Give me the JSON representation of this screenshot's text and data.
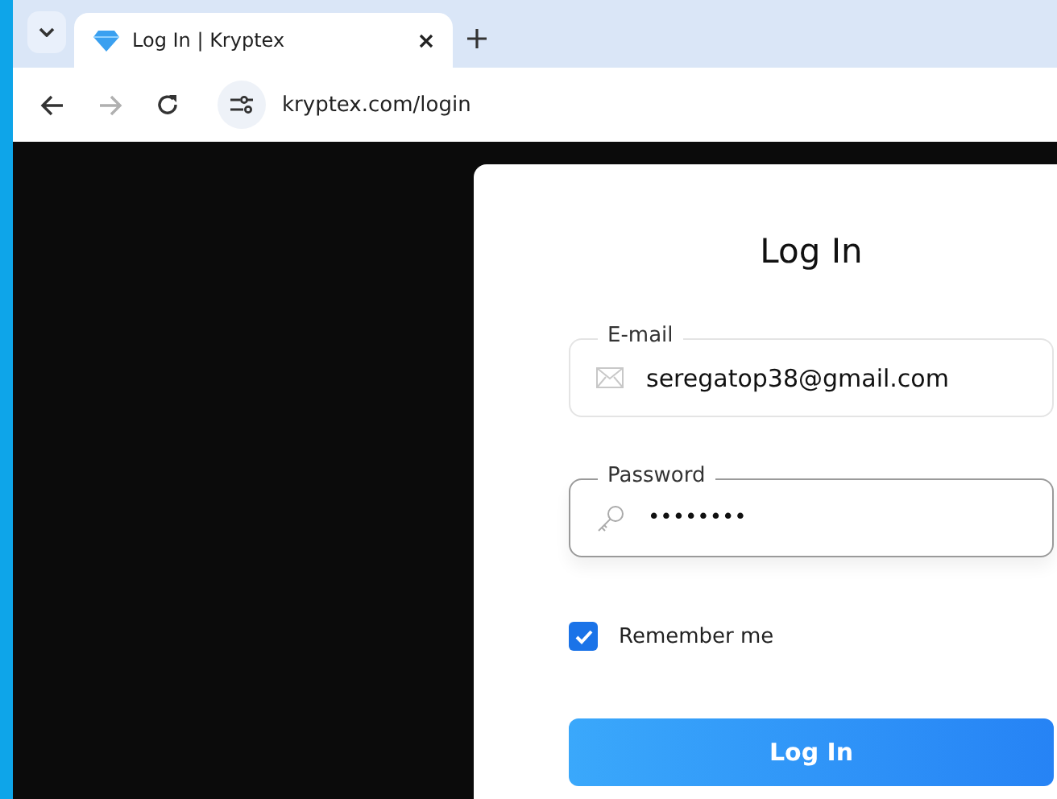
{
  "browser": {
    "tabs": [
      {
        "title": "Log In | Kryptex",
        "selected": true
      }
    ],
    "nav": {
      "forward_disabled": true
    },
    "address": "kryptex.com/login"
  },
  "login": {
    "title": "Log In",
    "fields": [
      {
        "kind": "email",
        "label": "E-mail",
        "value": "seregatop38@gmail.com",
        "focused": false
      },
      {
        "kind": "password",
        "label": "Password",
        "value": "••••••••",
        "focused": true
      }
    ],
    "remember": {
      "label": "Remember me",
      "checked": true
    },
    "submit": "Log In"
  }
}
